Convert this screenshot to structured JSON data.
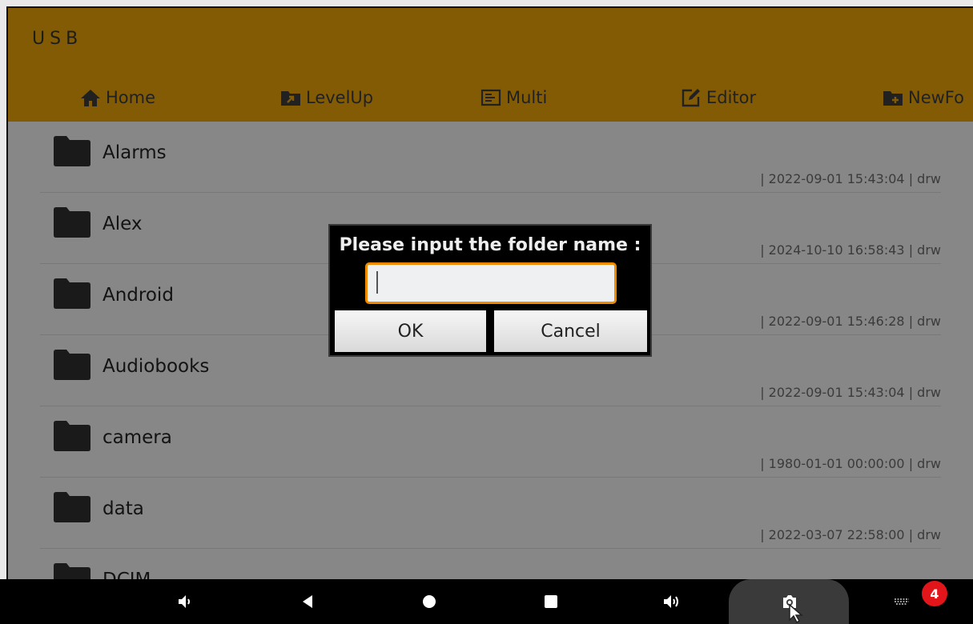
{
  "header": {
    "title": "USB"
  },
  "toolbar": [
    {
      "label": "Home",
      "icon": "home-icon"
    },
    {
      "label": "LevelUp",
      "icon": "level-up-icon"
    },
    {
      "label": "Multi",
      "icon": "multi-icon"
    },
    {
      "label": "Editor",
      "icon": "editor-icon"
    },
    {
      "label": "NewFo",
      "icon": "new-folder-icon"
    }
  ],
  "files": [
    {
      "name": "Alarms",
      "meta": "| 2022-09-01 15:43:04 | drw"
    },
    {
      "name": "Alex",
      "meta": "| 2024-10-10 16:58:43 | drw"
    },
    {
      "name": "Android",
      "meta": "| 2022-09-01 15:46:28 | drw"
    },
    {
      "name": "Audiobooks",
      "meta": "| 2022-09-01 15:43:04 | drw"
    },
    {
      "name": "camera",
      "meta": "| 1980-01-01 00:00:00 | drw"
    },
    {
      "name": "data",
      "meta": "| 2022-03-07 22:58:00 | drw"
    },
    {
      "name": "DCIM",
      "meta": ""
    }
  ],
  "dialog": {
    "prompt": "Please input the folder name :",
    "input_value": "",
    "ok_label": "OK",
    "cancel_label": "Cancel"
  },
  "navbar": {
    "badge_count": "4",
    "icons": [
      "volume-down-icon",
      "back-icon",
      "home-circle-icon",
      "recents-icon",
      "volume-up-icon",
      "screenshot-icon",
      "keyboard-icon"
    ]
  },
  "colors": {
    "header": "#e19e08",
    "input_border": "#f08a00",
    "badge": "#e2151a"
  }
}
